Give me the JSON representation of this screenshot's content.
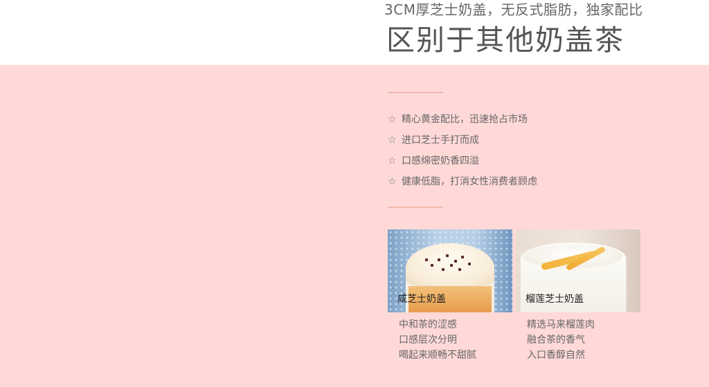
{
  "header": {
    "subtitle": "3CM厚芝士奶盖，无反式脂肪，独家配比",
    "title": "区别于其他奶盖茶"
  },
  "features": [
    {
      "star": "☆",
      "text": "精心黄金配比，迅速抢占市场"
    },
    {
      "star": "☆",
      "text": "进口芝士手打而成"
    },
    {
      "star": "☆",
      "text": "口感绵密奶香四溢"
    },
    {
      "star": "☆",
      "text": "健康低脂，打消女性消费者顾虑"
    }
  ],
  "products": [
    {
      "name": "咸芝士奶盖",
      "lines": [
        "中和茶的涩感",
        "口感层次分明",
        "喝起来顺畅不甜腻"
      ]
    },
    {
      "name": "榴莲芝士奶盖",
      "lines": [
        "精选马来榴莲肉",
        "融合茶的香气",
        "入口香醇自然"
      ]
    }
  ],
  "colors": {
    "background_pink": "#ffd9d8",
    "divider": "#f2b6ae",
    "text": "#666666"
  }
}
